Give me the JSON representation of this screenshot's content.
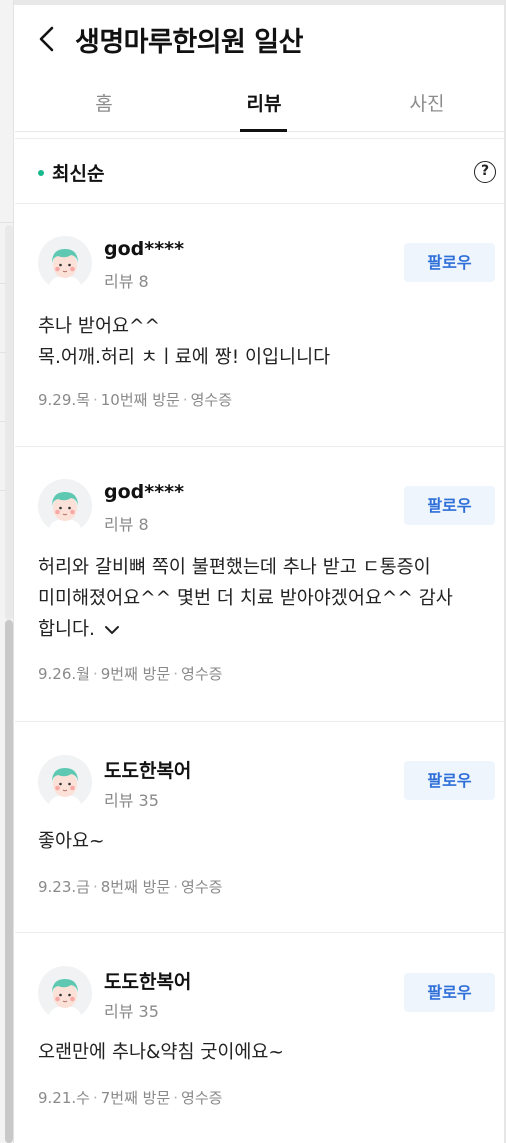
{
  "header": {
    "title": "생명마루한의원 일산"
  },
  "tabs": [
    {
      "label": "홈",
      "active": false
    },
    {
      "label": "리뷰",
      "active": true
    },
    {
      "label": "사진",
      "active": false
    }
  ],
  "sort": {
    "label": "최신순",
    "help_glyph": "?"
  },
  "reviews": [
    {
      "nickname": "god****",
      "review_count": "리뷰 8",
      "follow_label": "팔로우",
      "text_lines": [
        "추나 받어요^^",
        "목.어깨.허리 ㅊㅣ료에 짱! 이입니니다"
      ],
      "date": "9.29.목",
      "visit": "10번째 방문",
      "receipt": "영수증"
    },
    {
      "nickname": "god****",
      "review_count": "리뷰 8",
      "follow_label": "팔로우",
      "text_lines": [
        "허리와 갈비뼈 쪽이 불편했는데 추나 받고 ㄷ통증이",
        "미미해졌어요^^ 몇번 더 치료 받아야겠어요^^ 감사",
        "합니다."
      ],
      "date": "9.26.월",
      "visit": "9번째 방문",
      "receipt": "영수증"
    },
    {
      "nickname": "도도한복어",
      "review_count": "리뷰 35",
      "follow_label": "팔로우",
      "text_lines": [
        "좋아요~"
      ],
      "date": "9.23.금",
      "visit": "8번째 방문",
      "receipt": "영수증"
    },
    {
      "nickname": "도도한복어",
      "review_count": "리뷰 35",
      "follow_label": "팔로우",
      "text_lines": [
        "오랜만에 추나&약침 굿이에요~"
      ],
      "date": "9.21.수",
      "visit": "7번째 방문",
      "receipt": "영수증"
    }
  ],
  "colors": {
    "accent_dot": "#18b98c",
    "follow_text": "#2e6fd8",
    "follow_bg": "#eef5fd"
  },
  "icons": {
    "back": "chevron-left-icon",
    "help": "question-circle-icon",
    "more": "chevron-down-icon",
    "avatar": "default-avatar-icon"
  }
}
